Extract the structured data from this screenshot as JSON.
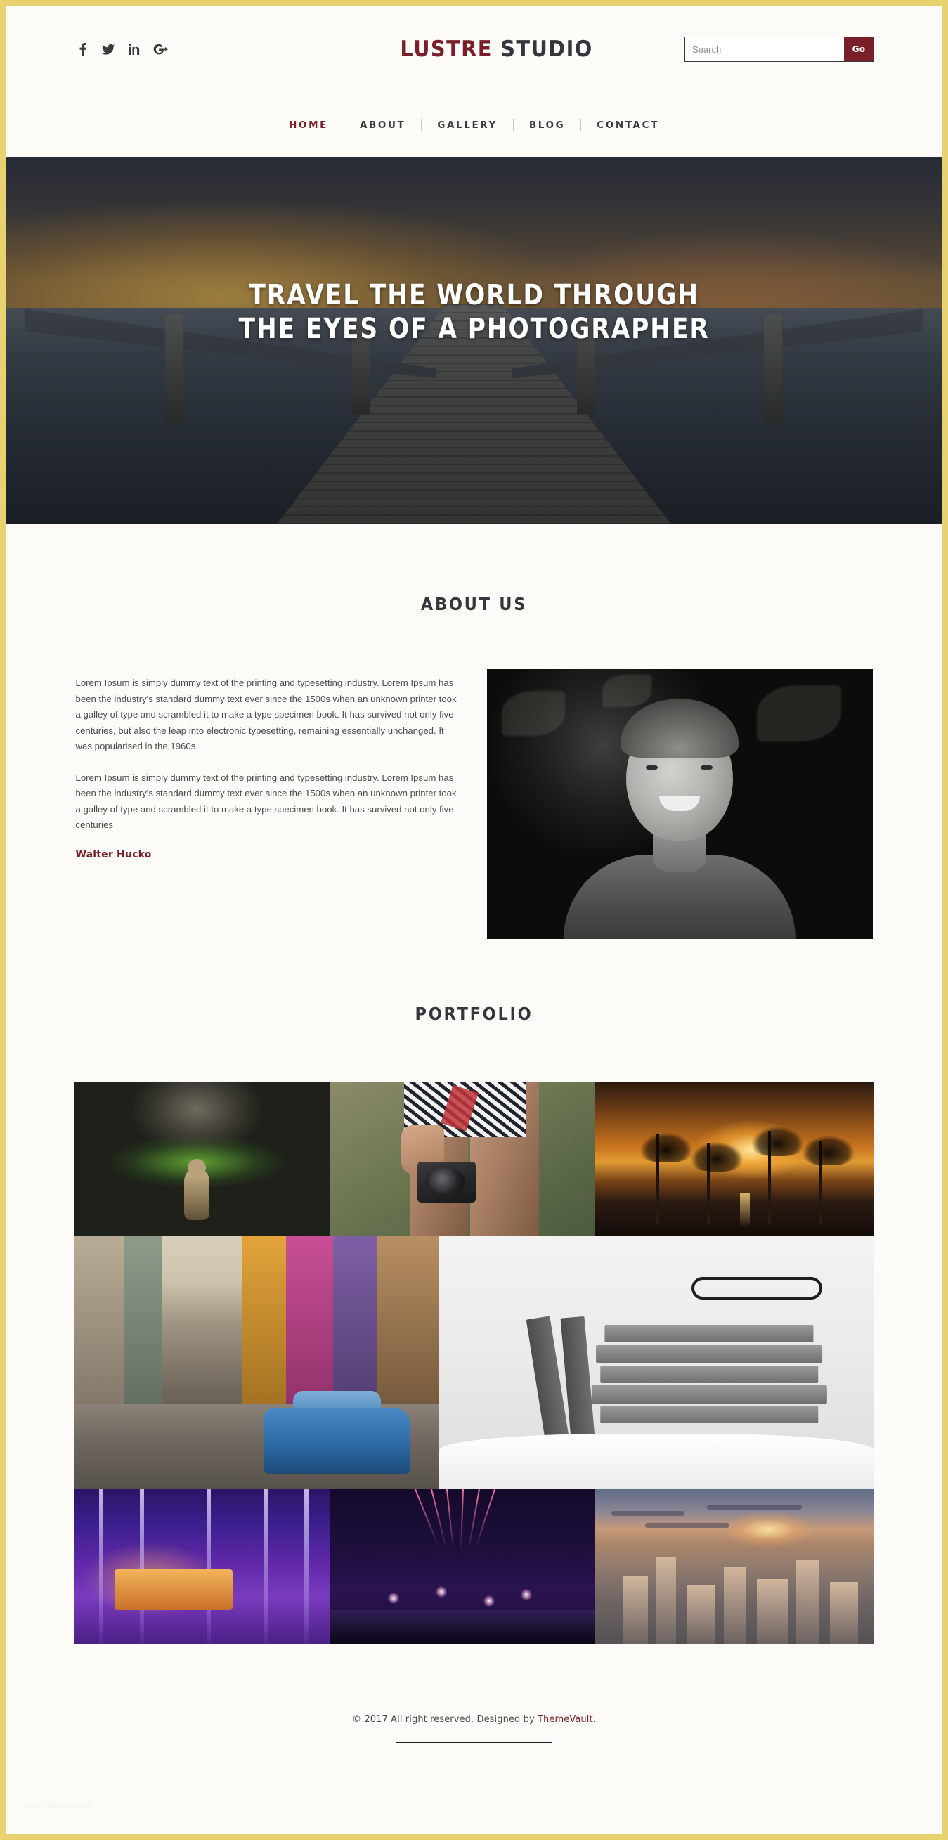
{
  "site": {
    "brand_part1": "LUSTRE",
    "brand_part2": "STUDIO",
    "accent_color": "#7a1f28",
    "dark_color": "#33363c",
    "frame_color": "#e8d270",
    "page_bg": "#fcfbf8"
  },
  "header": {
    "social": [
      {
        "name": "facebook-icon",
        "label": "f"
      },
      {
        "name": "twitter-icon",
        "label": "t"
      },
      {
        "name": "linkedin-icon",
        "label": "in"
      },
      {
        "name": "googleplus-icon",
        "label": "G+"
      }
    ],
    "search": {
      "placeholder": "Search",
      "value": "",
      "button_label": "Go"
    }
  },
  "nav": {
    "items": [
      {
        "label": "HOME",
        "active": true
      },
      {
        "label": "ABOUT",
        "active": false
      },
      {
        "label": "GALLERY",
        "active": false
      },
      {
        "label": "BLOG",
        "active": false
      },
      {
        "label": "CONTACT",
        "active": false
      }
    ]
  },
  "hero": {
    "headline_line1": "TRAVEL THE WORLD THROUGH",
    "headline_line2": "THE EYES OF A PHOTOGRAPHER",
    "image_alt": "wooden pier leading into the sea at dusk"
  },
  "about": {
    "title": "ABOUT US",
    "paragraph1": "Lorem Ipsum is simply dummy text of the printing and typesetting industry. Lorem Ipsum has been the industry's standard dummy text ever since the 1500s when an unknown printer took a galley of type and scrambled it to make a type specimen book. It has survived not only five centuries, but also the leap into electronic typesetting, remaining essentially unchanged. It was popularised in the 1960s",
    "paragraph2": "Lorem Ipsum is simply dummy text of the printing and typesetting industry. Lorem Ipsum has been the industry's standard dummy text ever since the 1500s when an unknown printer took a galley of type and scrambled it to make a type specimen book. It has survived not only five centuries",
    "signature": "Walter Hucko",
    "photo_alt": "black and white portrait of a smiling young man"
  },
  "portfolio": {
    "title": "PORTFOLIO",
    "rows": [
      {
        "items": [
          {
            "alt": "squirrel standing in green bokeh grass",
            "style": "img-squirrel"
          },
          {
            "alt": "woman in patterned shorts holding a camera",
            "style": "img-camera"
          },
          {
            "alt": "palm trees silhouetted against a beach sunset",
            "style": "img-palms"
          }
        ]
      },
      {
        "items": [
          {
            "alt": "colourful Havana street with vintage blue car",
            "style": "img-havana"
          },
          {
            "alt": "stack of old books with eyeglasses on snow",
            "style": "img-books"
          }
        ]
      },
      {
        "items": [
          {
            "alt": "purple and blue festival light installation",
            "style": "img-lights"
          },
          {
            "alt": "fireworks exploding over a night city skyline",
            "style": "img-fireworks"
          },
          {
            "alt": "aerial view of New York City at sunset",
            "style": "img-nyc"
          }
        ]
      }
    ]
  },
  "footer": {
    "copyright_prefix": "© 2017 All right reserved. Designed by ",
    "designer": "ThemeVault",
    "copyright_suffix": ".",
    "watermark": "www.lustrestudio.co"
  }
}
